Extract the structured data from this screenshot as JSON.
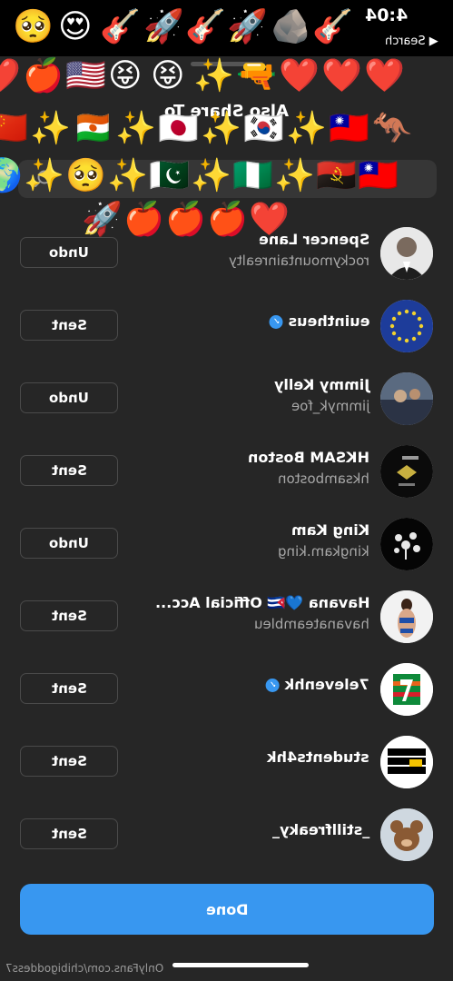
{
  "status_bar": {
    "time": "4:04",
    "back_label": "◀ Search",
    "emojis": [
      "🥺",
      "😍",
      "🎸",
      "🚀",
      "🎸",
      "🚀",
      "🪨",
      "🎸"
    ]
  },
  "sheet": {
    "title": "Also Share To",
    "search_placeholder": "Search",
    "done_label": "Done"
  },
  "sticker_rows": [
    [
      "❤️",
      "❤️",
      "❤️",
      "🔫",
      "✨",
      "😝",
      "😝",
      "🇺🇸",
      "🍎",
      "❤️"
    ],
    [
      "🦘",
      "🇹🇼",
      "✨",
      "🇰🇷",
      "✨",
      "🇯🇵",
      "✨",
      "🇳🇪",
      "✨",
      "🇨🇳"
    ],
    [
      "🇹🇼",
      "🇦🇴",
      "✨",
      "🇳🇬",
      "✨",
      "🇵🇰",
      "✨",
      "🥺",
      "✨",
      "🌍"
    ],
    [
      "❤️",
      "🍎",
      "🍎",
      "🍎",
      "🚀"
    ]
  ],
  "contacts": [
    {
      "name": "Spencer Lane",
      "username": "rockymountainrealty",
      "verified": false,
      "action": "Undo"
    },
    {
      "name": "euintheus",
      "username": "",
      "verified": true,
      "action": "Sent"
    },
    {
      "name": "Jimmy Kelly",
      "username": "jimmyk_foe",
      "verified": false,
      "action": "Undo"
    },
    {
      "name": "HKSAM Boston",
      "username": "hksamboston",
      "verified": false,
      "action": "Sent"
    },
    {
      "name": "King Kam",
      "username": "kingkam.king",
      "verified": false,
      "action": "Undo"
    },
    {
      "name": "Havana 💙🇨🇺 Official Acc...",
      "username": "havanateambleu",
      "verified": false,
      "action": "Sent"
    },
    {
      "name": "7elevenhk",
      "username": "",
      "verified": true,
      "action": "Sent"
    },
    {
      "name": "students4hk",
      "username": "",
      "verified": false,
      "action": "Sent"
    },
    {
      "name": "_stillfreaky_",
      "username": "",
      "verified": false,
      "action": "Sent"
    }
  ],
  "watermark": "OnlyFans.com/chibigoddess7",
  "colors": {
    "accent": "#3897f0",
    "sheet": "#262626",
    "button_border": "#4a4a4a"
  }
}
